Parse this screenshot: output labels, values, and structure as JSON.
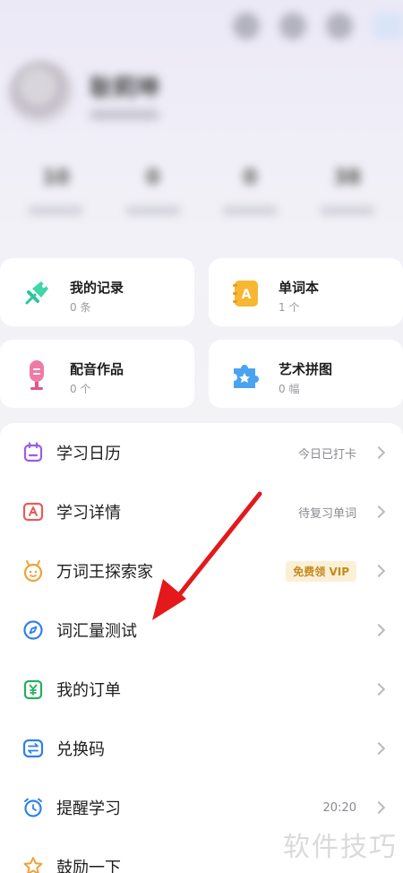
{
  "header": {
    "profile_name": "耿莉坤",
    "stats": [
      "10",
      "0",
      "0",
      "38"
    ]
  },
  "cards": [
    {
      "title": "我的记录",
      "count": "0 条",
      "icon": "pin-icon"
    },
    {
      "title": "单词本",
      "count": "1 个",
      "icon": "notebook-icon"
    },
    {
      "title": "配音作品",
      "count": "0 个",
      "icon": "microphone-icon"
    },
    {
      "title": "艺术拼图",
      "count": "0 幅",
      "icon": "puzzle-icon"
    }
  ],
  "menu": [
    {
      "label": "学习日历",
      "right": "今日已打卡",
      "icon": "calendar-icon",
      "color": "#9b5de5"
    },
    {
      "label": "学习详情",
      "right": "待复习单词",
      "icon": "detail-icon",
      "color": "#e85b5b"
    },
    {
      "label": "万词王探索家",
      "badge": "免费领 VIP",
      "icon": "explorer-icon",
      "color": "#f0a13a"
    },
    {
      "label": "词汇量测试",
      "icon": "compass-icon",
      "color": "#2f80ed"
    },
    {
      "label": "我的订单",
      "icon": "order-icon",
      "color": "#27ae60"
    },
    {
      "label": "兑换码",
      "icon": "exchange-icon",
      "color": "#2f80ed"
    },
    {
      "label": "提醒学习",
      "right": "20:20",
      "icon": "alarm-icon",
      "color": "#2f80ed"
    },
    {
      "label": "鼓励一下",
      "icon": "star-icon",
      "color": "#f0a13a"
    }
  ],
  "watermark": "软件技巧",
  "colors": {
    "arrow": "#e3191b",
    "accent": "#2f80ed",
    "vip": "#c48a1e"
  }
}
